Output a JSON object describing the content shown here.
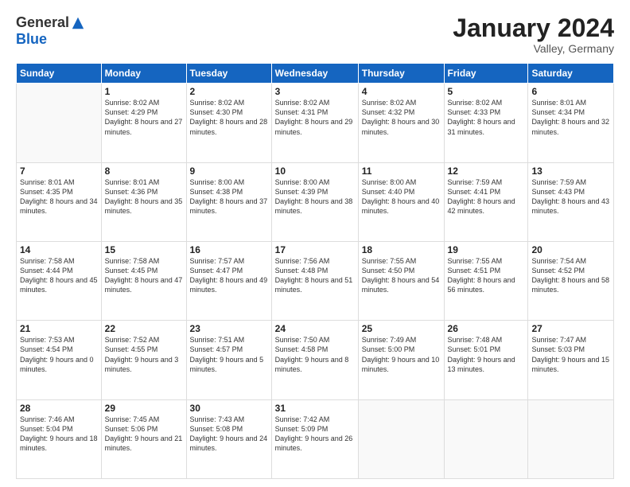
{
  "header": {
    "logo_general": "General",
    "logo_blue": "Blue",
    "month_title": "January 2024",
    "location": "Valley, Germany"
  },
  "weekdays": [
    "Sunday",
    "Monday",
    "Tuesday",
    "Wednesday",
    "Thursday",
    "Friday",
    "Saturday"
  ],
  "weeks": [
    [
      {
        "day": "",
        "sunrise": "",
        "sunset": "",
        "daylight": ""
      },
      {
        "day": "1",
        "sunrise": "Sunrise: 8:02 AM",
        "sunset": "Sunset: 4:29 PM",
        "daylight": "Daylight: 8 hours and 27 minutes."
      },
      {
        "day": "2",
        "sunrise": "Sunrise: 8:02 AM",
        "sunset": "Sunset: 4:30 PM",
        "daylight": "Daylight: 8 hours and 28 minutes."
      },
      {
        "day": "3",
        "sunrise": "Sunrise: 8:02 AM",
        "sunset": "Sunset: 4:31 PM",
        "daylight": "Daylight: 8 hours and 29 minutes."
      },
      {
        "day": "4",
        "sunrise": "Sunrise: 8:02 AM",
        "sunset": "Sunset: 4:32 PM",
        "daylight": "Daylight: 8 hours and 30 minutes."
      },
      {
        "day": "5",
        "sunrise": "Sunrise: 8:02 AM",
        "sunset": "Sunset: 4:33 PM",
        "daylight": "Daylight: 8 hours and 31 minutes."
      },
      {
        "day": "6",
        "sunrise": "Sunrise: 8:01 AM",
        "sunset": "Sunset: 4:34 PM",
        "daylight": "Daylight: 8 hours and 32 minutes."
      }
    ],
    [
      {
        "day": "7",
        "sunrise": "Sunrise: 8:01 AM",
        "sunset": "Sunset: 4:35 PM",
        "daylight": "Daylight: 8 hours and 34 minutes."
      },
      {
        "day": "8",
        "sunrise": "Sunrise: 8:01 AM",
        "sunset": "Sunset: 4:36 PM",
        "daylight": "Daylight: 8 hours and 35 minutes."
      },
      {
        "day": "9",
        "sunrise": "Sunrise: 8:00 AM",
        "sunset": "Sunset: 4:38 PM",
        "daylight": "Daylight: 8 hours and 37 minutes."
      },
      {
        "day": "10",
        "sunrise": "Sunrise: 8:00 AM",
        "sunset": "Sunset: 4:39 PM",
        "daylight": "Daylight: 8 hours and 38 minutes."
      },
      {
        "day": "11",
        "sunrise": "Sunrise: 8:00 AM",
        "sunset": "Sunset: 4:40 PM",
        "daylight": "Daylight: 8 hours and 40 minutes."
      },
      {
        "day": "12",
        "sunrise": "Sunrise: 7:59 AM",
        "sunset": "Sunset: 4:41 PM",
        "daylight": "Daylight: 8 hours and 42 minutes."
      },
      {
        "day": "13",
        "sunrise": "Sunrise: 7:59 AM",
        "sunset": "Sunset: 4:43 PM",
        "daylight": "Daylight: 8 hours and 43 minutes."
      }
    ],
    [
      {
        "day": "14",
        "sunrise": "Sunrise: 7:58 AM",
        "sunset": "Sunset: 4:44 PM",
        "daylight": "Daylight: 8 hours and 45 minutes."
      },
      {
        "day": "15",
        "sunrise": "Sunrise: 7:58 AM",
        "sunset": "Sunset: 4:45 PM",
        "daylight": "Daylight: 8 hours and 47 minutes."
      },
      {
        "day": "16",
        "sunrise": "Sunrise: 7:57 AM",
        "sunset": "Sunset: 4:47 PM",
        "daylight": "Daylight: 8 hours and 49 minutes."
      },
      {
        "day": "17",
        "sunrise": "Sunrise: 7:56 AM",
        "sunset": "Sunset: 4:48 PM",
        "daylight": "Daylight: 8 hours and 51 minutes."
      },
      {
        "day": "18",
        "sunrise": "Sunrise: 7:55 AM",
        "sunset": "Sunset: 4:50 PM",
        "daylight": "Daylight: 8 hours and 54 minutes."
      },
      {
        "day": "19",
        "sunrise": "Sunrise: 7:55 AM",
        "sunset": "Sunset: 4:51 PM",
        "daylight": "Daylight: 8 hours and 56 minutes."
      },
      {
        "day": "20",
        "sunrise": "Sunrise: 7:54 AM",
        "sunset": "Sunset: 4:52 PM",
        "daylight": "Daylight: 8 hours and 58 minutes."
      }
    ],
    [
      {
        "day": "21",
        "sunrise": "Sunrise: 7:53 AM",
        "sunset": "Sunset: 4:54 PM",
        "daylight": "Daylight: 9 hours and 0 minutes."
      },
      {
        "day": "22",
        "sunrise": "Sunrise: 7:52 AM",
        "sunset": "Sunset: 4:55 PM",
        "daylight": "Daylight: 9 hours and 3 minutes."
      },
      {
        "day": "23",
        "sunrise": "Sunrise: 7:51 AM",
        "sunset": "Sunset: 4:57 PM",
        "daylight": "Daylight: 9 hours and 5 minutes."
      },
      {
        "day": "24",
        "sunrise": "Sunrise: 7:50 AM",
        "sunset": "Sunset: 4:58 PM",
        "daylight": "Daylight: 9 hours and 8 minutes."
      },
      {
        "day": "25",
        "sunrise": "Sunrise: 7:49 AM",
        "sunset": "Sunset: 5:00 PM",
        "daylight": "Daylight: 9 hours and 10 minutes."
      },
      {
        "day": "26",
        "sunrise": "Sunrise: 7:48 AM",
        "sunset": "Sunset: 5:01 PM",
        "daylight": "Daylight: 9 hours and 13 minutes."
      },
      {
        "day": "27",
        "sunrise": "Sunrise: 7:47 AM",
        "sunset": "Sunset: 5:03 PM",
        "daylight": "Daylight: 9 hours and 15 minutes."
      }
    ],
    [
      {
        "day": "28",
        "sunrise": "Sunrise: 7:46 AM",
        "sunset": "Sunset: 5:04 PM",
        "daylight": "Daylight: 9 hours and 18 minutes."
      },
      {
        "day": "29",
        "sunrise": "Sunrise: 7:45 AM",
        "sunset": "Sunset: 5:06 PM",
        "daylight": "Daylight: 9 hours and 21 minutes."
      },
      {
        "day": "30",
        "sunrise": "Sunrise: 7:43 AM",
        "sunset": "Sunset: 5:08 PM",
        "daylight": "Daylight: 9 hours and 24 minutes."
      },
      {
        "day": "31",
        "sunrise": "Sunrise: 7:42 AM",
        "sunset": "Sunset: 5:09 PM",
        "daylight": "Daylight: 9 hours and 26 minutes."
      },
      {
        "day": "",
        "sunrise": "",
        "sunset": "",
        "daylight": ""
      },
      {
        "day": "",
        "sunrise": "",
        "sunset": "",
        "daylight": ""
      },
      {
        "day": "",
        "sunrise": "",
        "sunset": "",
        "daylight": ""
      }
    ]
  ]
}
